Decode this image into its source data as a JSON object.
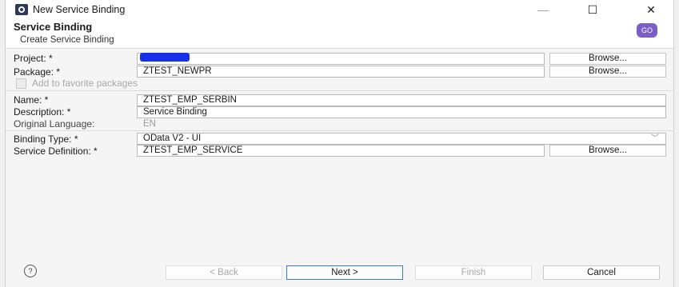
{
  "window": {
    "title": "New Service Binding",
    "minimize": "—",
    "maximize": "☐",
    "close": "✕"
  },
  "header": {
    "title": "Service Binding",
    "subtitle": "Create Service Binding",
    "icon_text": "GO"
  },
  "form": {
    "project": {
      "label": "Project: *",
      "value": "",
      "browse": "Browse..."
    },
    "package": {
      "label": "Package: *",
      "value": "ZTEST_NEWPR",
      "browse": "Browse..."
    },
    "favorite": {
      "label": "Add to favorite packages",
      "checked": false
    },
    "name": {
      "label": "Name: *",
      "value": "ZTEST_EMP_SERBIN"
    },
    "description": {
      "label": "Description: *",
      "value": "Service Binding"
    },
    "original_language": {
      "label": "Original Language:",
      "value": "EN"
    },
    "binding_type": {
      "label": "Binding Type: *",
      "value": "OData V2 - UI"
    },
    "service_definition": {
      "label": "Service Definition: *",
      "value": "ZTEST_EMP_SERVICE",
      "browse": "Browse..."
    }
  },
  "footer": {
    "help": "?",
    "back": "< Back",
    "next": "Next >",
    "finish": "Finish",
    "cancel": "Cancel"
  },
  "colors": {
    "accent": "#3b7ad8",
    "banner_icon": "#7b5fc9",
    "redaction": "#1530e8"
  }
}
